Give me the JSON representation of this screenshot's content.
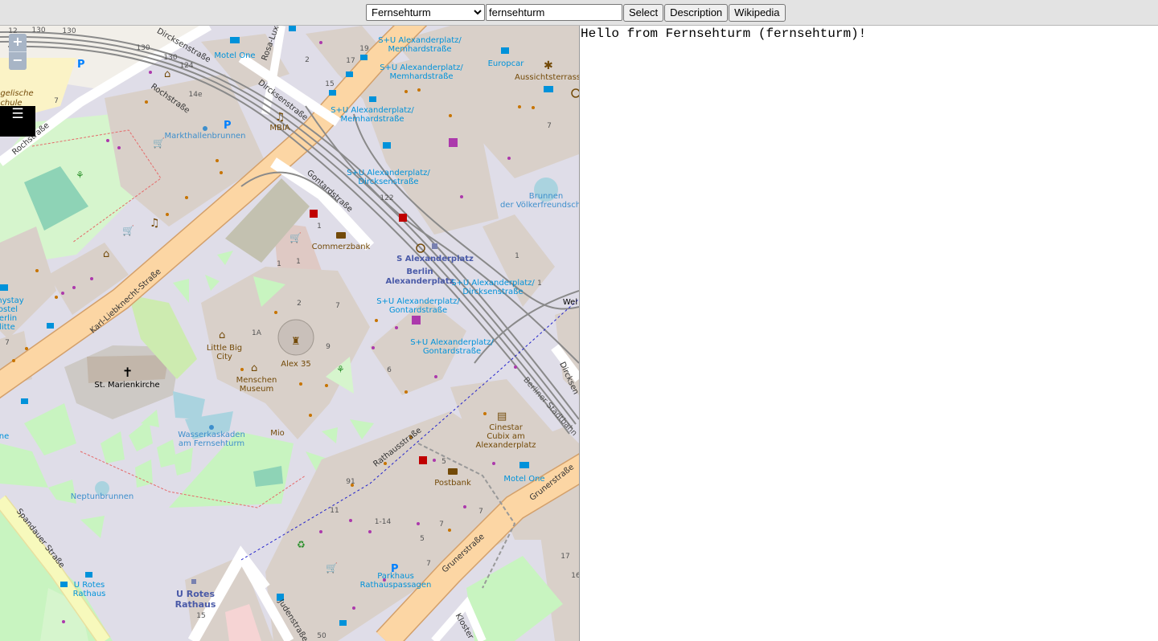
{
  "toolbar": {
    "place_select": {
      "selected": "Fernsehturm",
      "options": [
        "Fernsehturm"
      ]
    },
    "query_input": {
      "value": "fernsehturm"
    },
    "select_label": "Select",
    "description_label": "Description",
    "wikipedia_label": "Wikipedia"
  },
  "map": {
    "zoom_in_label": "+",
    "zoom_out_label": "−",
    "menu_label": "☰",
    "colors": {
      "background": "#dfdde8",
      "building": "#d9d0c9",
      "green": "#c8f4c0",
      "primary_road": "#fcd6a4",
      "rail": "#888888",
      "water": "#aad3df",
      "poi_blue": "#0092da",
      "poi_brown": "#734a08",
      "pharmacy_red": "#c00000"
    },
    "labels": {
      "motel_one_1": "Motel One",
      "europcar": "Europcar",
      "aussichtsterrasse": "Aussichtsterrass",
      "su_mem_1": "S+U Alexanderplatz/",
      "su_mem_1b": "Memhardstraße",
      "su_mem_2": "S+U Alexanderplatz/",
      "su_mem_2b": "Memhardstraße",
      "su_mem_3": "S+U Alexanderplatz/",
      "su_mem_3b": "Memhardstraße",
      "markthallenbrunnen": "Markthallenbrunnen",
      "brunnen_1": "Brunnen",
      "brunnen_2": "der Völkerfreundsch",
      "su_dirck_1": "S+U Alexanderplatz/",
      "su_dirck_1b": "Dircksenstraße",
      "commerzbank": "Commerzbank",
      "s_alex": "S Alexanderplatz",
      "berlin_alex_1": "Berlin",
      "berlin_alex_2": "Alexanderplatz",
      "su_dirck_2": "S+U Alexanderplatz/",
      "su_dirck_2b": "Dircksenstraße",
      "su_gont_1": "S+U Alexanderplatz/",
      "su_gont_1b": "Gontardstraße",
      "su_gont_2": "S+U Alexanderplatz/",
      "su_gont_2b": "Gontardstraße",
      "little_big_city_1": "Little Big",
      "little_big_city_2": "City",
      "alex35": "Alex 35",
      "menschen_museum_1": "Menschen",
      "menschen_museum_2": "Museum",
      "st_marienkirche": "St. Marienkirche",
      "mio": "Mio",
      "wasserkaskaden_1": "Wasserkaskaden",
      "wasserkaskaden_2": "am Fernsehturm",
      "neptunbrunnen": "Neptunbrunnen",
      "cinestar_1": "Cinestar",
      "cinestar_2": "Cubix am",
      "cinestar_3": "Alexanderplatz",
      "postbank": "Postbank",
      "motel_one_2": "Motel One",
      "parkhaus_1": "Parkhaus",
      "parkhaus_2": "Rathauspassagen",
      "u_rotes_rathaus_1": "U Rotes",
      "u_rotes_rathaus_2": "Rathaus",
      "u_rotes_small_1": "U Rotes",
      "u_rotes_small_2": "Rathaus",
      "hostel_1": "nystay",
      "hostel_2": "ostel",
      "hostel_3": "erlin",
      "hostel_4": "litte",
      "evang_1": "gelische",
      "evang_2": "chule",
      "welt": "Wel",
      "vue": "ne",
      "mbia": "MBIA",
      "street_dircksen_1": "Dircksenstraße",
      "street_dircksen_2": "Dircksenstraße",
      "street_dircksen_3": "Dircksen",
      "street_rosa": "Rosa-Luxe",
      "street_roch_1": "Rochstraße",
      "street_roch_2": "Rochstraße",
      "street_gontard": "Gontardstraße",
      "street_karl": "Karl-Liebknecht-Straße",
      "street_rathaus": "Rathausstraße",
      "street_berliner": "Berliner Stadtbahn",
      "street_gruner_1": "Grunerstraße",
      "street_gruner_2": "Grunerstraße",
      "street_spandauer": "Spandauer Straße",
      "street_juden": "Judenstraße",
      "street_kloster": "Kloster"
    },
    "numbers": {
      "n1": "17",
      "n2": "19",
      "n3": "2",
      "n4": "15",
      "n5": "14e",
      "n6": "7",
      "n7": "122",
      "n8": "1",
      "n9": "1",
      "n10": "1",
      "n11": "1",
      "n12": "2",
      "n13": "7",
      "n14": "1A",
      "n15": "9",
      "n16": "6",
      "n17": "5",
      "n18": "91",
      "n19": "11",
      "n20": "1-14",
      "n21": "7",
      "n22": "5",
      "n23": "7",
      "n24": "17",
      "n25": "16",
      "n26": "15",
      "n27": "50",
      "n28": "7",
      "n29": "7",
      "n30": "1",
      "n31": "7",
      "n32": "130",
      "n33": "130",
      "n34": "130",
      "n35": "130",
      "n36": "124",
      "n37": "12"
    }
  },
  "output": {
    "text": "Hello from Fernsehturm (fernsehturm)!"
  }
}
